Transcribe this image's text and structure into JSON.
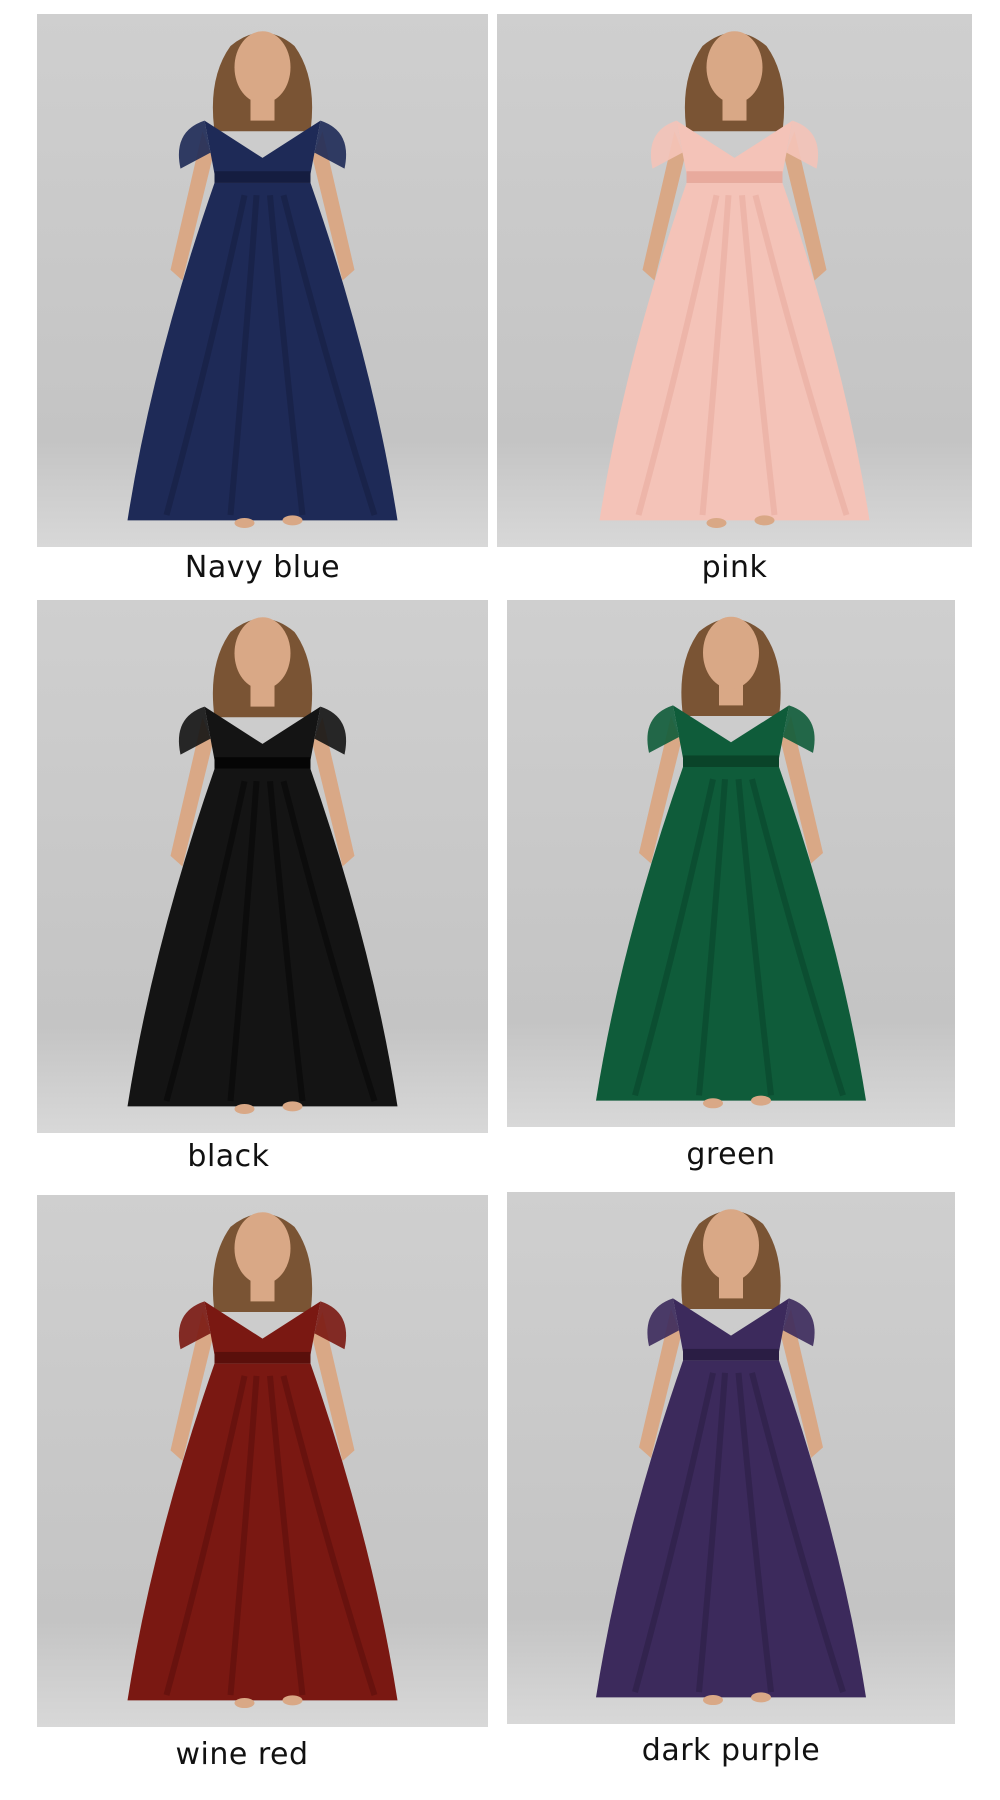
{
  "variants": [
    {
      "label": "Navy blue",
      "dress_color": "#1e2a57",
      "dress_shade": "#151d40"
    },
    {
      "label": "pink",
      "dress_color": "#f4c3b8",
      "dress_shade": "#e8aa9d"
    },
    {
      "label": "black",
      "dress_color": "#141414",
      "dress_shade": "#050505"
    },
    {
      "label": "green",
      "dress_color": "#0f5c3a",
      "dress_shade": "#0a4429"
    },
    {
      "label": "wine red",
      "dress_color": "#7a1812",
      "dress_shade": "#5a0f0b"
    },
    {
      "label": "dark purple",
      "dress_color": "#3c2a5c",
      "dress_shade": "#2a1d44"
    }
  ]
}
